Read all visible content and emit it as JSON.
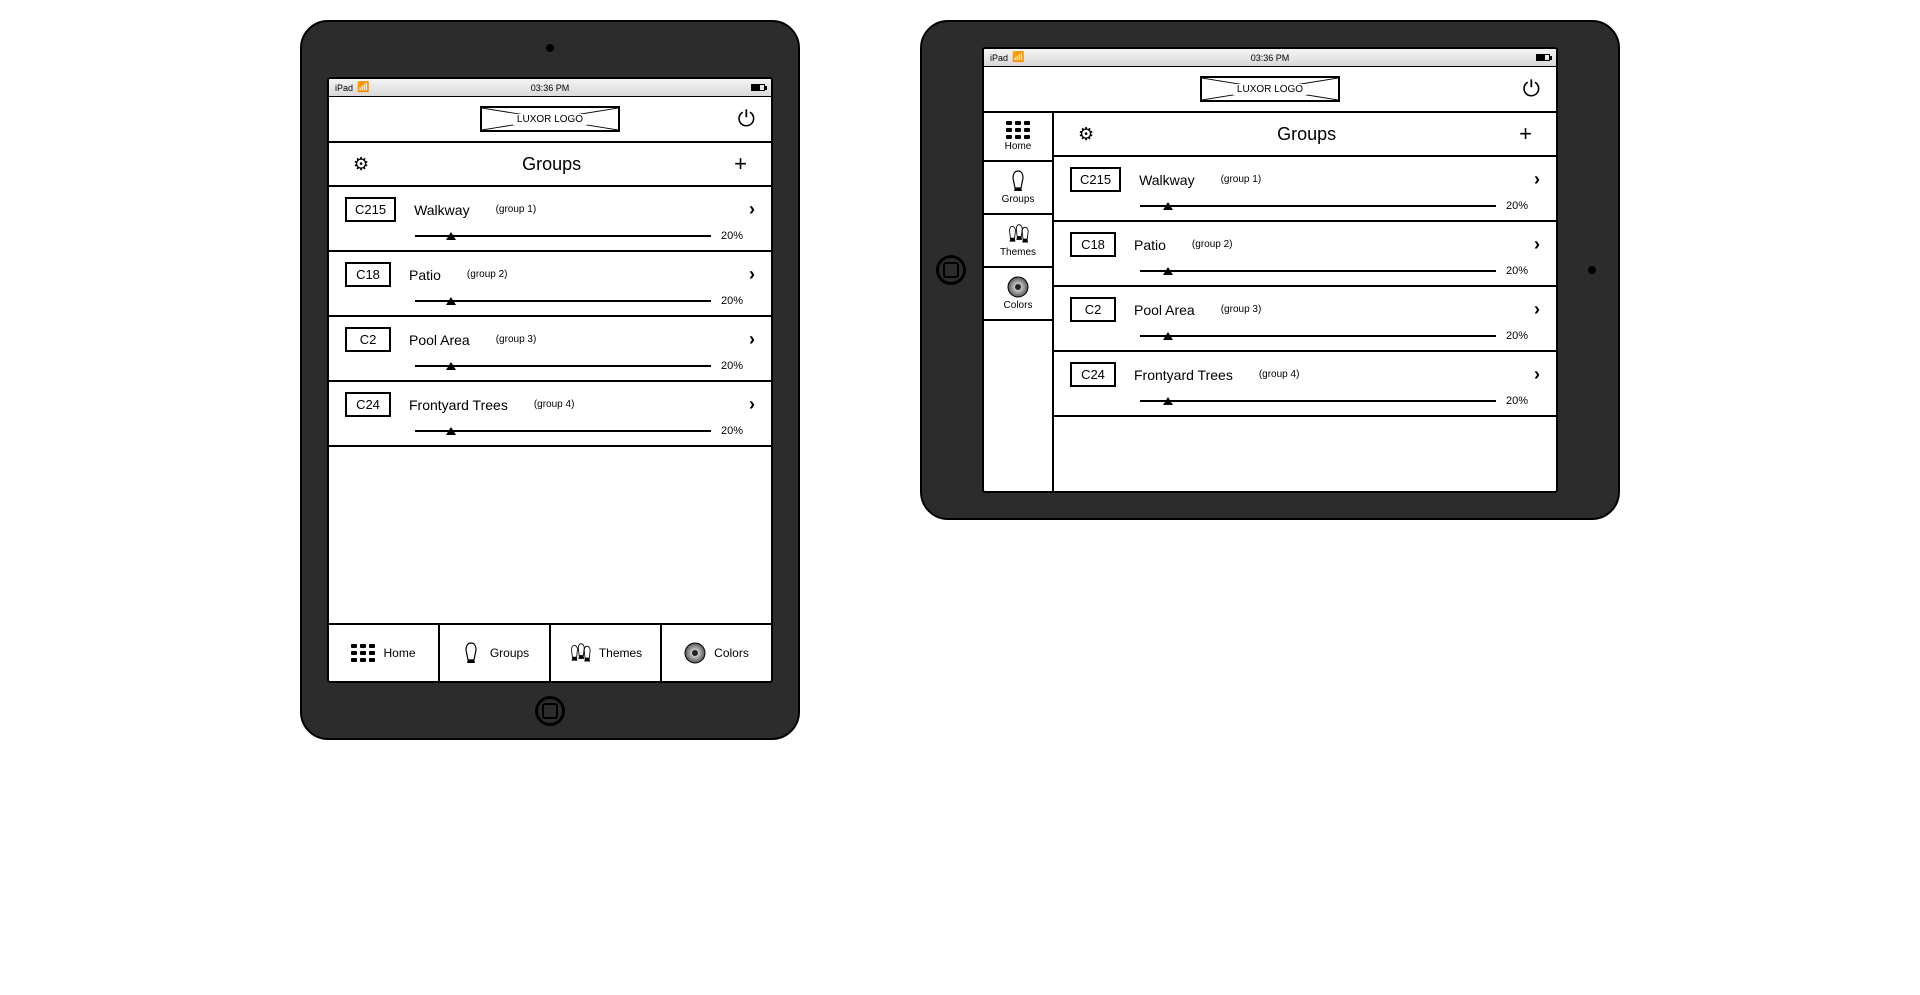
{
  "status": {
    "device": "iPad",
    "time": "03:36 PM"
  },
  "header": {
    "logo": "LUXOR LOGO"
  },
  "section": {
    "title": "Groups"
  },
  "groups": [
    {
      "code": "C215",
      "name": "Walkway",
      "sub": "(group 1)",
      "pct": "20%",
      "slider": 12
    },
    {
      "code": "C18",
      "name": "Patio",
      "sub": "(group 2)",
      "pct": "20%",
      "slider": 12
    },
    {
      "code": "C2",
      "name": "Pool Area",
      "sub": "(group 3)",
      "pct": "20%",
      "slider": 12
    },
    {
      "code": "C24",
      "name": "Frontyard Trees",
      "sub": "(group 4)",
      "pct": "20%",
      "slider": 12
    }
  ],
  "nav": [
    {
      "label": "Home"
    },
    {
      "label": "Groups"
    },
    {
      "label": "Themes"
    },
    {
      "label": "Colors"
    }
  ]
}
